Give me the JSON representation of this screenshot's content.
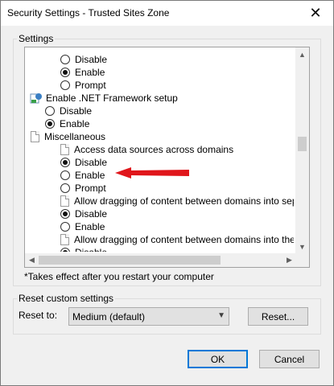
{
  "window": {
    "title": "Security Settings - Trusted Sites Zone",
    "close_glyph": "✕"
  },
  "settings_group": {
    "label": "Settings",
    "tree": [
      {
        "kind": "radio",
        "label": "Disable",
        "checked": false,
        "indent": 1
      },
      {
        "kind": "radio",
        "label": "Enable",
        "checked": true,
        "indent": 1
      },
      {
        "kind": "radio",
        "label": "Prompt",
        "checked": false,
        "indent": 1
      },
      {
        "kind": "net-header",
        "label": "Enable .NET Framework setup",
        "indent": 0
      },
      {
        "kind": "radio",
        "label": "Disable",
        "checked": false,
        "indent": 0.5
      },
      {
        "kind": "radio",
        "label": "Enable",
        "checked": true,
        "indent": 0.5
      },
      {
        "kind": "doc-header",
        "label": "Miscellaneous",
        "indent": 0
      },
      {
        "kind": "doc-header",
        "label": "Access data sources across domains",
        "indent": 1
      },
      {
        "kind": "radio",
        "label": "Disable",
        "checked": true,
        "indent": 1
      },
      {
        "kind": "radio",
        "label": "Enable",
        "checked": false,
        "indent": 1
      },
      {
        "kind": "radio",
        "label": "Prompt",
        "checked": false,
        "indent": 1
      },
      {
        "kind": "doc-header",
        "label": "Allow dragging of content between domains into separate wi",
        "indent": 1
      },
      {
        "kind": "radio",
        "label": "Disable",
        "checked": true,
        "indent": 1
      },
      {
        "kind": "radio",
        "label": "Enable",
        "checked": false,
        "indent": 1
      },
      {
        "kind": "doc-header",
        "label": "Allow dragging of content between domains into the same wi",
        "indent": 1
      },
      {
        "kind": "radio",
        "label": "Disable",
        "checked": true,
        "indent": 1
      }
    ]
  },
  "note": "*Takes effect after you restart your computer",
  "reset_group": {
    "label": "Reset custom settings",
    "reset_to_label": "Reset to:",
    "selected_level": "Medium (default)",
    "reset_button": "Reset..."
  },
  "buttons": {
    "ok": "OK",
    "cancel": "Cancel"
  },
  "colors": {
    "annotation_arrow": "#e0161b",
    "default_button_border": "#0078d7"
  }
}
